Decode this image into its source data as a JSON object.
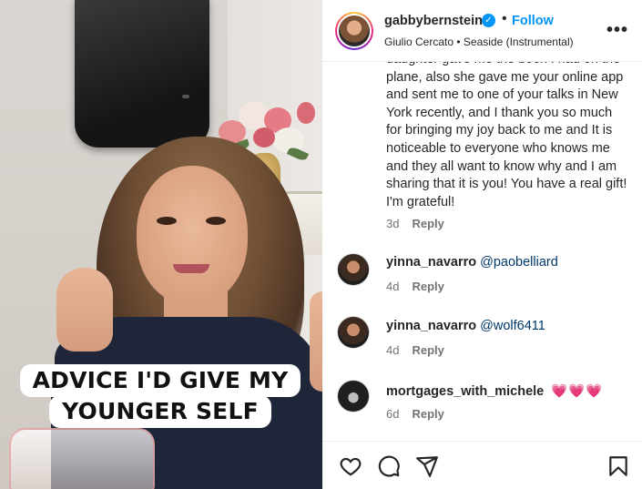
{
  "media": {
    "caption_line1": "ADVICE I'D GIVE MY",
    "caption_line2": "YOUNGER SELF"
  },
  "header": {
    "username": "gabbybernstein",
    "verified": true,
    "separator": "•",
    "follow_label": "Follow",
    "audio": "Giulio Cercato • Seaside (Instrumental)",
    "more_label": "•••"
  },
  "thread": {
    "continued_comment": "daughter gave me the book I had on the plane, also she gave me your online app and sent me to one of your talks in New York recently, and I thank you so much for bringing my joy back to me and It is noticeable to everyone who knows me and they all want to know why and I am sharing that it is you! You have a real gift! I'm grateful!",
    "continued_meta": {
      "time": "3d",
      "reply": "Reply"
    },
    "comments": [
      {
        "user": "yinna_navarro",
        "mention": "@paobelliard",
        "time": "4d",
        "reply": "Reply"
      },
      {
        "user": "yinna_navarro",
        "mention": "@wolf6411",
        "time": "4d",
        "reply": "Reply"
      },
      {
        "user": "mortgages_with_michele",
        "text": "💗💗💗",
        "time": "6d",
        "reply": "Reply"
      }
    ]
  },
  "actions": {
    "icons": [
      "heart-icon",
      "comment-icon",
      "share-icon",
      "bookmark-icon"
    ]
  },
  "colors": {
    "link_blue": "#0095f6",
    "mention_blue": "#00376b",
    "muted": "#737373",
    "heart_pink": "#ff3040"
  }
}
